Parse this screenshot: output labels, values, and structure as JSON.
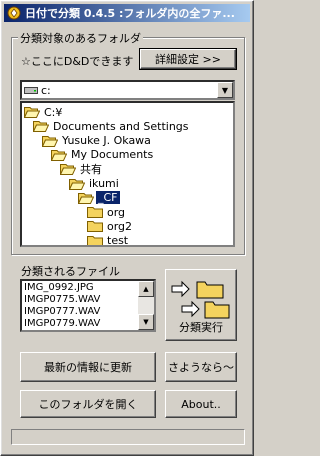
{
  "window": {
    "title": "日付で分類 0.4.5 :フォルダ内の全ファ..."
  },
  "source_group": {
    "legend": "分類対象のあるフォルダ",
    "drop_hint": "☆ここにD&Dできます",
    "detail_button": "詳細設定 >>",
    "drive_value": "c:"
  },
  "folder_tree": [
    {
      "label": "C:¥",
      "depth": 0,
      "selected": false,
      "open": true
    },
    {
      "label": "Documents and Settings",
      "depth": 1,
      "selected": false,
      "open": true
    },
    {
      "label": "Yusuke J. Okawa",
      "depth": 2,
      "selected": false,
      "open": true
    },
    {
      "label": "My Documents",
      "depth": 3,
      "selected": false,
      "open": true
    },
    {
      "label": "共有",
      "depth": 4,
      "selected": false,
      "open": true
    },
    {
      "label": "ikumi",
      "depth": 5,
      "selected": false,
      "open": true
    },
    {
      "label": "_CF",
      "depth": 6,
      "selected": true,
      "open": true
    },
    {
      "label": "org",
      "depth": 7,
      "selected": false,
      "open": false
    },
    {
      "label": "org2",
      "depth": 7,
      "selected": false,
      "open": false
    },
    {
      "label": "test",
      "depth": 7,
      "selected": false,
      "open": false
    }
  ],
  "files_group": {
    "label": "分類されるファイル",
    "files": [
      "IMG_0992.JPG",
      "IMGP0775.WAV",
      "IMGP0777.WAV",
      "IMGP0779.WAV"
    ]
  },
  "buttons": {
    "classify": "分類実行",
    "refresh": "最新の情報に更新",
    "goodbye": "さようなら〜",
    "open_folder": "このフォルダを開く",
    "about": "About.."
  },
  "colors": {
    "face": "#d4d0c8",
    "selection": "#0a246a",
    "folder": "#f4d35e"
  },
  "icons": {
    "app": "app-icon",
    "folder": "folder-icon",
    "arrow": "arrow-right-icon",
    "drive": "hard-drive-icon"
  }
}
